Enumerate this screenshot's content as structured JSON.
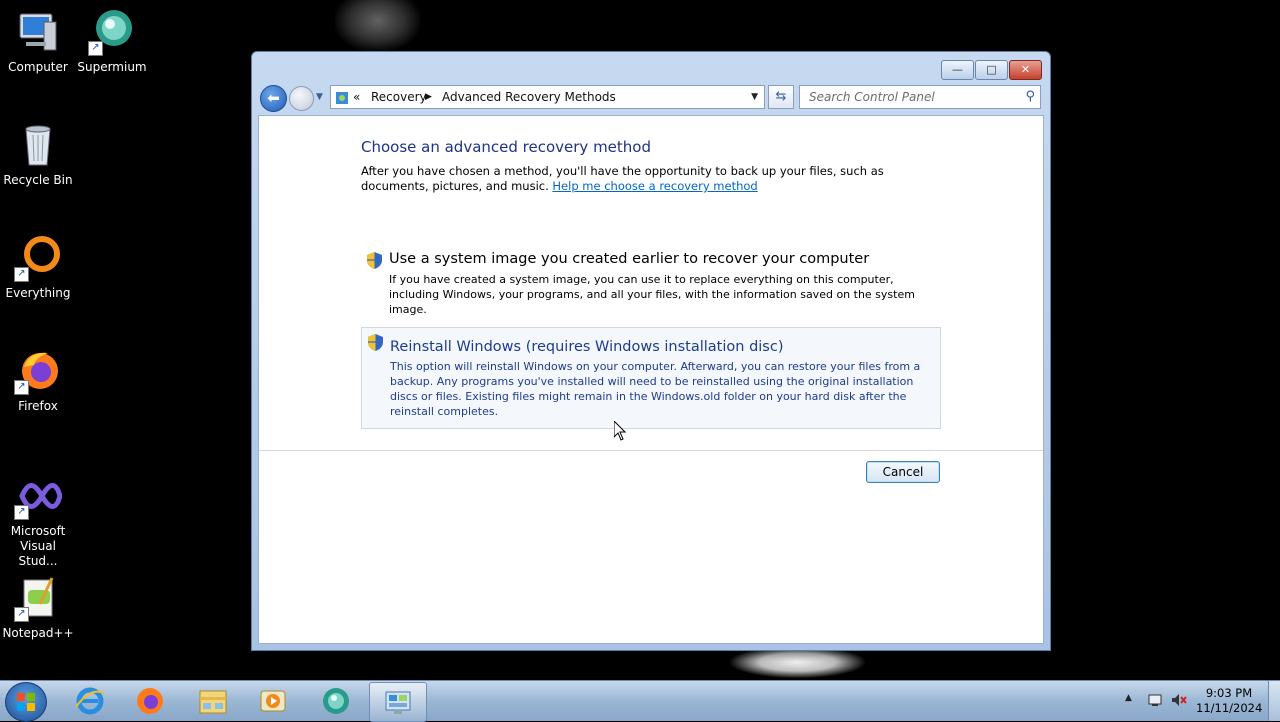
{
  "desktop": {
    "icons": [
      {
        "label_line1": "Computer",
        "label_line2": ""
      },
      {
        "label_line1": "Supermium",
        "label_line2": ""
      },
      {
        "label_line1": "Recycle Bin",
        "label_line2": ""
      },
      {
        "label_line1": "Everything",
        "label_line2": ""
      },
      {
        "label_line1": "Firefox",
        "label_line2": ""
      },
      {
        "label_line1": "Microsoft",
        "label_line2": "Visual Stud..."
      },
      {
        "label_line1": "Notepad++",
        "label_line2": ""
      }
    ]
  },
  "window": {
    "controls": {
      "minimize": "—",
      "maximize": "□",
      "close": "✕"
    },
    "address": {
      "chevron": "«",
      "breadcrumb": [
        "Recovery",
        "Advanced Recovery Methods"
      ],
      "separator": "▶",
      "dropdown": "▼"
    },
    "refresh_glyph": "⇆",
    "search": {
      "placeholder": "Search Control Panel",
      "value": ""
    },
    "content": {
      "heading": "Choose an advanced recovery method",
      "intro": "After you have chosen a method, you'll have the opportunity to back up your files, such as documents, pictures, and music.",
      "help_link": "Help me choose a recovery method",
      "options": [
        {
          "title": "Use a system image you created earlier to recover your computer",
          "description": "If you have created a system image, you can use it to replace everything on this computer, including Windows, your programs, and all your files, with the information saved on the system image."
        },
        {
          "title": "Reinstall Windows (requires Windows installation disc)",
          "description": "This option will reinstall Windows on your computer. Afterward, you can restore your files from a backup. Any programs you've installed will need to be reinstalled using the original installation discs or files. Existing files might remain in the Windows.old folder on your hard disk after the reinstall completes."
        }
      ],
      "cancel_label": "Cancel"
    }
  },
  "taskbar": {
    "clock": {
      "time": "9:03 PM",
      "date": "11/11/2024"
    },
    "tray_arrow": "▲"
  },
  "colors": {
    "heading": "#1e3287",
    "link": "#0066cc",
    "highlight_option_text": "#1e3c8f",
    "taskbar": "#9bb7d5"
  },
  "icons": [
    "computer-icon",
    "supermium-icon",
    "recycle-bin-icon",
    "everything-icon",
    "firefox-icon",
    "visual-studio-icon",
    "notepad-plus-plus-icon",
    "shield-icon",
    "search-icon",
    "back-arrow-icon",
    "forward-arrow-icon",
    "refresh-icon",
    "start-orb-icon",
    "internet-explorer-icon",
    "file-explorer-icon",
    "media-player-icon",
    "control-panel-icon",
    "action-center-icon",
    "volume-muted-icon"
  ]
}
